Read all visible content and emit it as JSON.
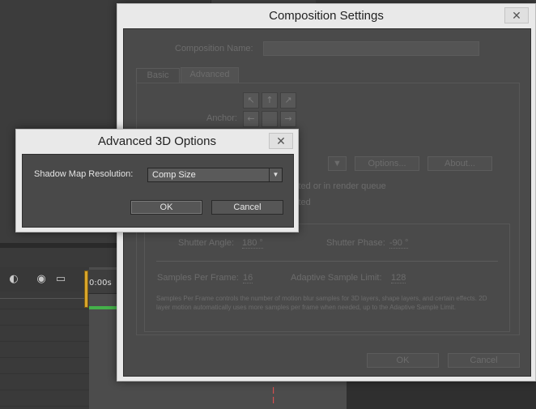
{
  "background": {
    "timeline_time": "0:00s"
  },
  "comp_settings": {
    "title": "Composition Settings",
    "close_glyph": "✕",
    "name_label": "Composition Name:",
    "name_value": "",
    "tabs": [
      {
        "label": "Basic"
      },
      {
        "label": "Advanced"
      }
    ],
    "anchor_label": "Anchor:",
    "renderer_options_button": "Options...",
    "renderer_about_button": "About...",
    "nested_text_1": "sted or in render queue",
    "nested_text_2": "sted",
    "shutter_angle_label": "Shutter Angle:",
    "shutter_angle_value": "180 °",
    "shutter_phase_label": "Shutter Phase:",
    "shutter_phase_value": "-90 °",
    "samples_label": "Samples Per Frame:",
    "samples_value": "16",
    "adaptive_label": "Adaptive Sample Limit:",
    "adaptive_value": "128",
    "help_text": "Samples Per Frame controls the number of motion blur samples for 3D layers, shape layers, and certain effects. 2D layer motion automatically uses more samples per frame when needed, up to the Adaptive Sample Limit.",
    "ok_label": "OK",
    "cancel_label": "Cancel"
  },
  "adv3d": {
    "title": "Advanced 3D Options",
    "close_glyph": "✕",
    "shadow_label": "Shadow Map Resolution:",
    "shadow_value": "Comp Size",
    "ok_label": "OK",
    "cancel_label": "Cancel"
  }
}
